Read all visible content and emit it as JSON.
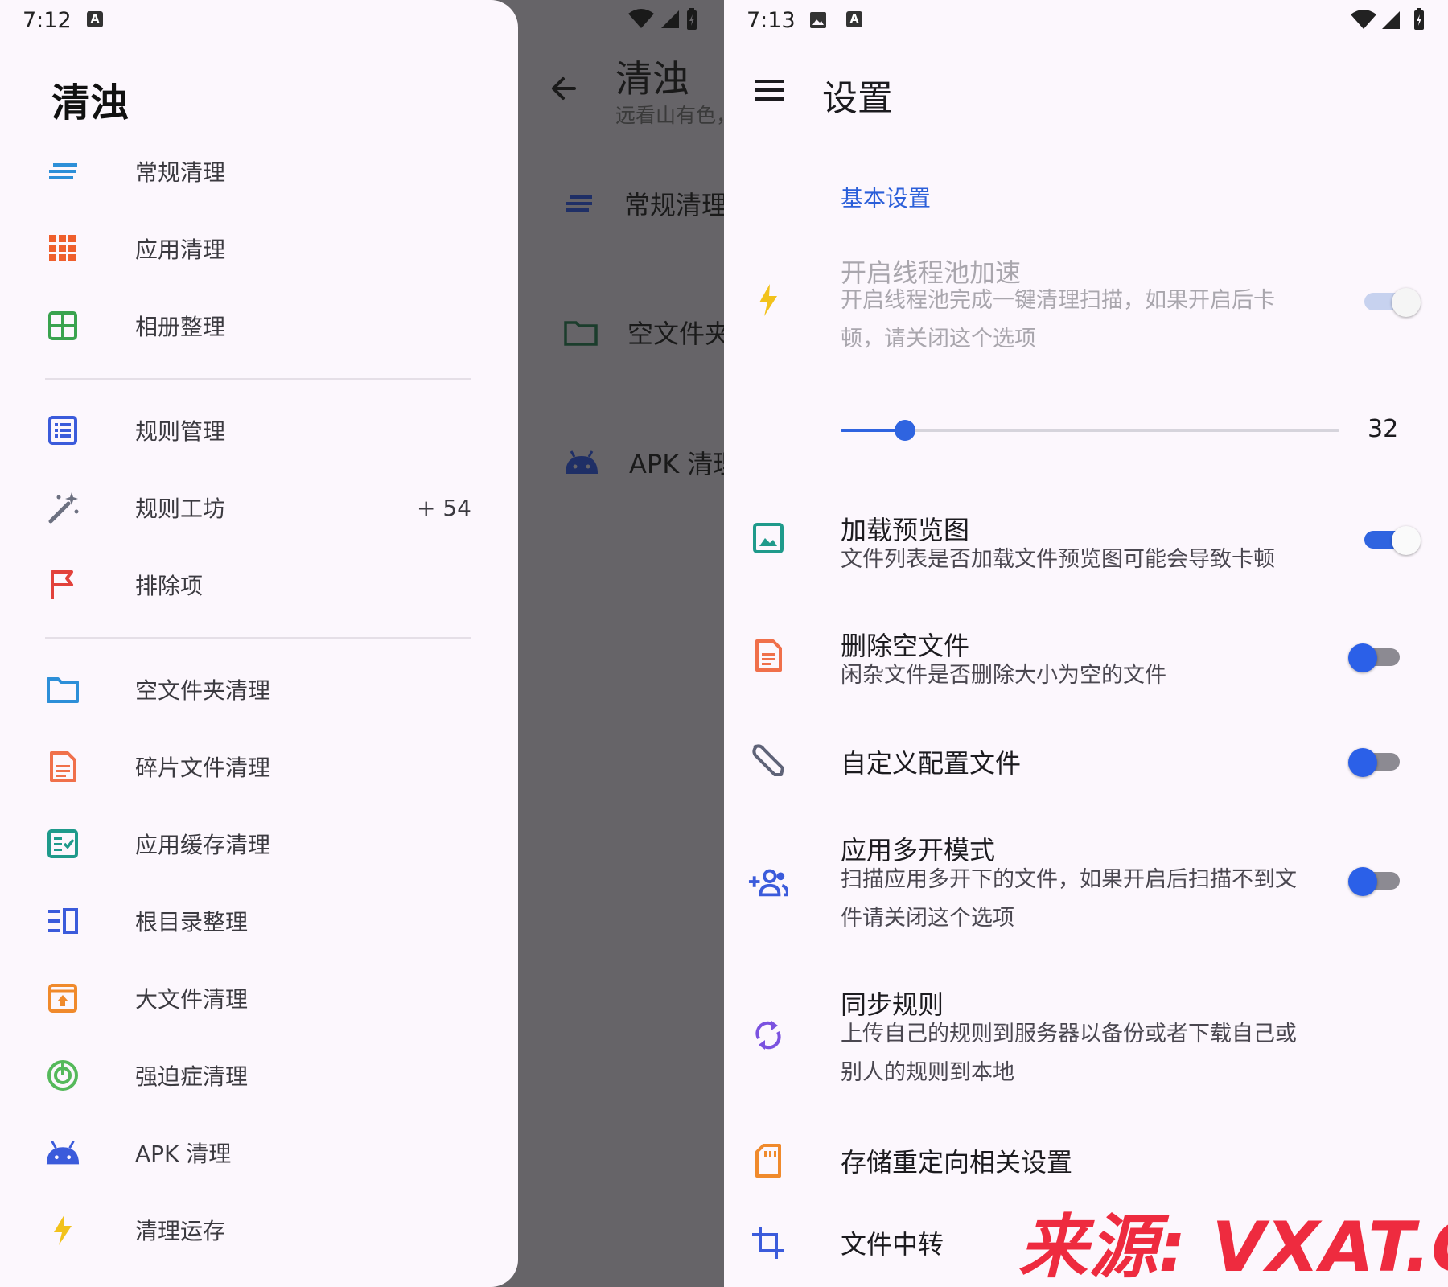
{
  "left": {
    "status": {
      "time": "7:12",
      "badge": "A"
    },
    "drawer": {
      "title": "清浊",
      "groups": [
        [
          {
            "label": "常规清理",
            "icon": "lines-icon",
            "color": "#2d8fd8"
          },
          {
            "label": "应用清理",
            "icon": "apps-grid-icon",
            "color": "#ef5f2c"
          },
          {
            "label": "相册整理",
            "icon": "grid-window-icon",
            "color": "#3aa34f"
          }
        ],
        [
          {
            "label": "规则管理",
            "icon": "list-box-icon",
            "color": "#3b5bdb"
          },
          {
            "label": "规则工坊",
            "icon": "magic-wand-icon",
            "color": "#6c7080",
            "badge": "+ 54"
          },
          {
            "label": "排除项",
            "icon": "flag-icon",
            "color": "#e2413b"
          }
        ],
        [
          {
            "label": "空文件夹清理",
            "icon": "folder-icon",
            "color": "#2d8fd8"
          },
          {
            "label": "碎片文件清理",
            "icon": "document-icon",
            "color": "#f0704b"
          },
          {
            "label": "应用缓存清理",
            "icon": "checklist-icon",
            "color": "#1f9a8b"
          },
          {
            "label": "根目录整理",
            "icon": "root-list-icon",
            "color": "#3b5bdb"
          },
          {
            "label": "大文件清理",
            "icon": "archive-icon",
            "color": "#f08a2c"
          },
          {
            "label": "强迫症清理",
            "icon": "radar-icon",
            "color": "#55b95b"
          },
          {
            "label": "APK 清理",
            "icon": "android-icon",
            "color": "#3b5bdb"
          },
          {
            "label": "清理运存",
            "icon": "bolt-icon",
            "color": "#f2c21b"
          }
        ]
      ]
    },
    "background_app": {
      "title": "清浊",
      "subtitle": "远看山有色，",
      "items": [
        {
          "label": "常规清理",
          "icon": "lines-icon"
        },
        {
          "label": "空文件夹",
          "icon": "folder-icon"
        },
        {
          "label": "APK 清理",
          "icon": "android-icon"
        }
      ]
    }
  },
  "right": {
    "status": {
      "time": "7:13",
      "badge": "A"
    },
    "title": "设置",
    "section": "基本设置",
    "prefs": [
      {
        "title": "开启线程池加速",
        "summary": "开启线程池完成一键清理扫描，如果开启后卡顿，请关闭这个选项",
        "icon": "bolt-icon",
        "color": "#f2c21b",
        "switch": "disabled-on"
      },
      {
        "title": "加载预览图",
        "summary": "文件列表是否加载文件预览图可能会导致卡顿",
        "icon": "image-icon",
        "color": "#1f9a8b",
        "switch": "on"
      },
      {
        "title": "删除空文件",
        "summary": "闲杂文件是否删除大小为空的文件",
        "icon": "document-icon",
        "color": "#f0704b",
        "switch": "off"
      },
      {
        "title": "自定义配置文件",
        "summary": "",
        "icon": "wrench-icon",
        "color": "#5f6378",
        "switch": "off"
      },
      {
        "title": "应用多开模式",
        "summary": "扫描应用多开下的文件，如果开启后扫描不到文件请关闭这个选项",
        "icon": "add-group-icon",
        "color": "#3b5bdb",
        "switch": "off"
      },
      {
        "title": "同步规则",
        "summary": "上传自己的规则到服务器以备份或者下载自己或别人的规则到本地",
        "icon": "sync-icon",
        "color": "#7b52e0",
        "switch": ""
      },
      {
        "title": "存储重定向相关设置",
        "summary": "",
        "icon": "sd-card-icon",
        "color": "#f08a2c",
        "switch": ""
      },
      {
        "title": "文件中转",
        "summary": "",
        "icon": "crop-icon",
        "color": "#3b5bdb",
        "switch": ""
      }
    ],
    "slider": {
      "value": 32,
      "min": 1,
      "max": 240
    }
  },
  "watermark": "来源: VXAT.COM"
}
